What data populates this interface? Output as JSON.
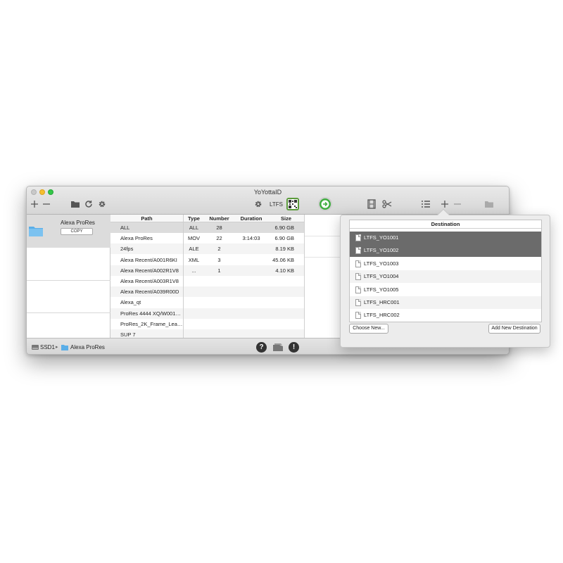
{
  "window": {
    "title": "YoYottaID"
  },
  "toolbar": {
    "ltfs_label": "LTFS"
  },
  "sources": {
    "items": [
      {
        "name": "Alexa ProRes",
        "copy_label": "COPY"
      }
    ]
  },
  "table": {
    "path_header": "Path",
    "columns": [
      "Type",
      "Number",
      "Duration",
      "Size"
    ],
    "paths": [
      "ALL",
      "Alexa ProRes",
      "24fps",
      "Alexa Recent/A001R6KI",
      "Alexa Recent/A002R1V8",
      "Alexa Recent/A003R1V8",
      "Alexa Recent/A039R00D",
      "Alexa_qt",
      "ProRes 4444 XQ/W001…",
      "ProRes_2K_Frame_Lea…",
      "SUP 7"
    ],
    "rows": [
      {
        "type": "ALL",
        "number": "28",
        "duration": "",
        "size": "6.90 GB"
      },
      {
        "type": "MOV",
        "number": "22",
        "duration": "3:14:03",
        "size": "6.90 GB"
      },
      {
        "type": "ALE",
        "number": "2",
        "duration": "",
        "size": "8.19 KB"
      },
      {
        "type": "XML",
        "number": "3",
        "duration": "",
        "size": "45.06 KB"
      },
      {
        "type": "...",
        "number": "1",
        "duration": "",
        "size": "4.10 KB"
      }
    ]
  },
  "statusbar": {
    "breadcrumb": [
      "SSD1",
      "Alexa ProRes"
    ]
  },
  "popover": {
    "header": "Destination",
    "destinations": [
      {
        "label": "LTFS_YO1001",
        "selected": true
      },
      {
        "label": "LTFS_YO1002",
        "selected": true
      },
      {
        "label": "LTFS_YO1003",
        "selected": false
      },
      {
        "label": "LTFS_YO1004",
        "selected": false
      },
      {
        "label": "LTFS_YO1005",
        "selected": false
      },
      {
        "label": "LTFS_HRC001",
        "selected": false
      },
      {
        "label": "LTFS_HRC002",
        "selected": false
      }
    ],
    "choose_new_label": "Choose New...",
    "add_new_label": "Add New Destination"
  },
  "colors": {
    "selected_row": "#6b6b6b",
    "go_button": "#3fae3f",
    "folder": "#5aaee8"
  },
  "icons": [
    "plus-icon",
    "minus-icon",
    "folder-icon",
    "refresh-icon",
    "gear-icon",
    "qr-code-icon",
    "go-arrow-icon",
    "film-icon",
    "scissors-icon",
    "list-icon",
    "help-icon",
    "drive-icon",
    "alert-icon",
    "document-icon"
  ]
}
